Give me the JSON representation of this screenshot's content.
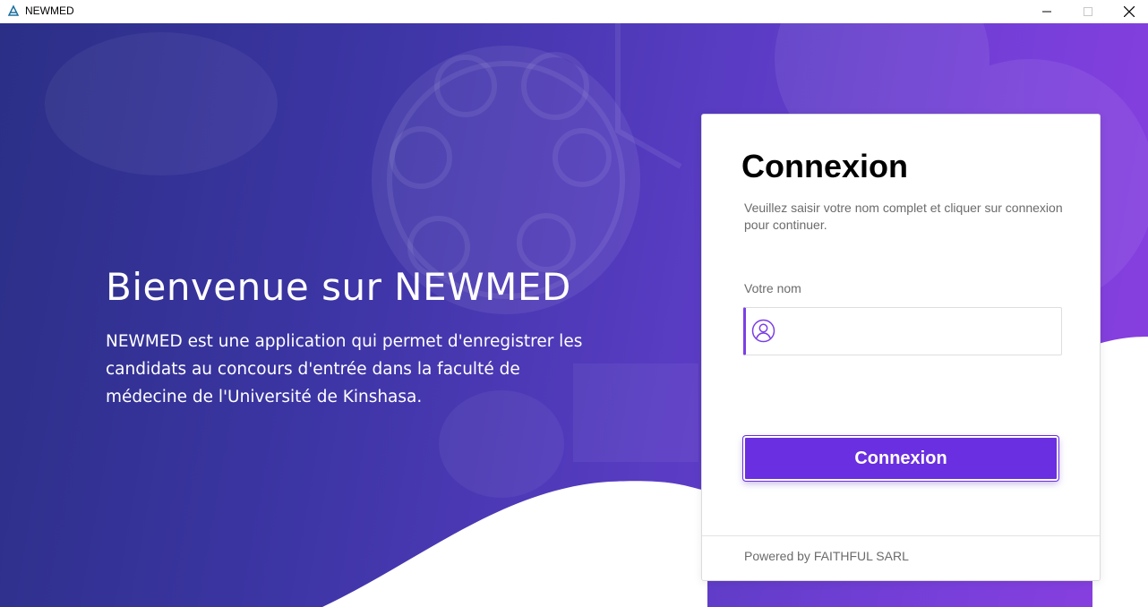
{
  "window": {
    "title": "NEWMED",
    "minimize_icon": "minimize-icon",
    "maximize_icon": "maximize-icon",
    "close_icon": "close-icon"
  },
  "hero": {
    "title": "Bienvenue sur NEWMED",
    "description": "NEWMED est une application qui permet d'enregistrer les candidats au concours d'entrée dans la faculté de médecine de l'Université de Kinshasa."
  },
  "login": {
    "title": "Connexion",
    "subtitle": "Veuillez saisir votre nom complet et cliquer sur connexion pour continuer.",
    "name_label": "Votre nom",
    "name_value": "",
    "name_icon": "user-circle-icon",
    "submit_label": "Connexion",
    "footer": "Powered by FAITHFUL SARL"
  },
  "colors": {
    "accent": "#6a2fe0",
    "input_accent": "#7b3fe4",
    "gradient_start": "#2b2f86",
    "gradient_end": "#8b3fe0"
  }
}
